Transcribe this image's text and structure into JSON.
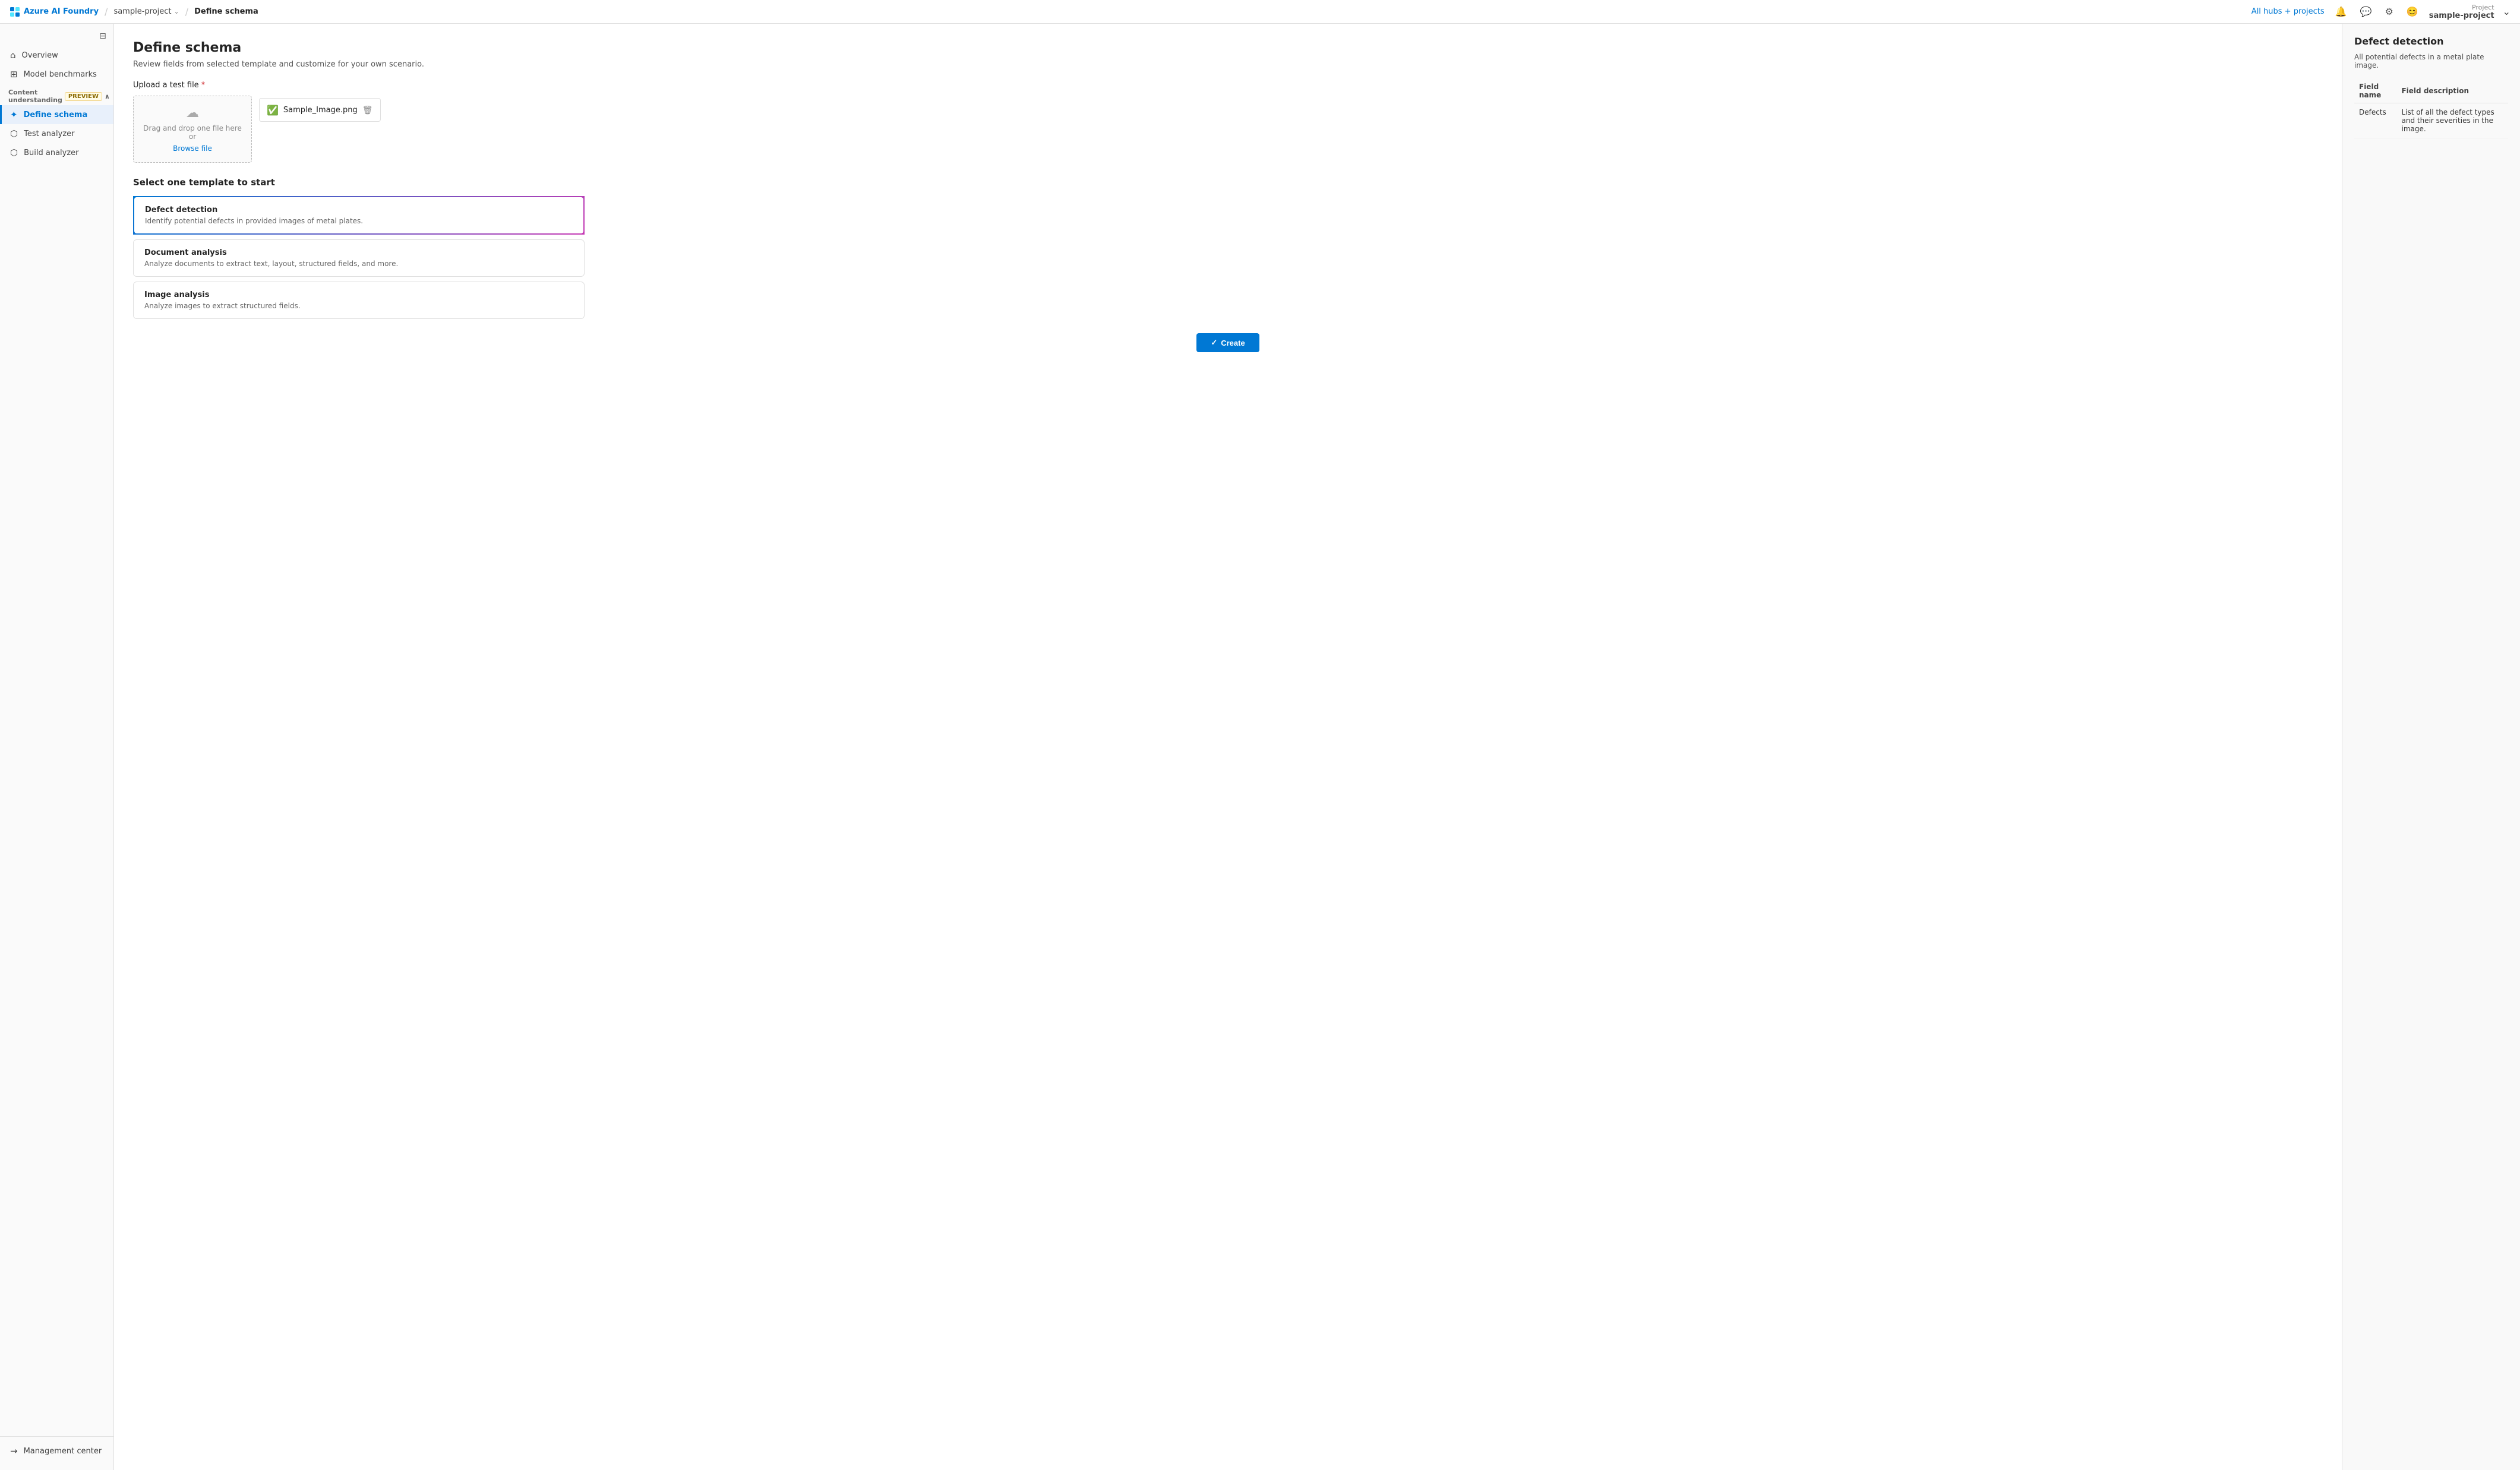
{
  "topnav": {
    "brand_label": "Azure AI Foundry",
    "breadcrumb_project": "sample-project",
    "breadcrumb_page": "Define schema",
    "hub_label": "All hubs + projects",
    "project_label": "Project",
    "project_name": "sample-project"
  },
  "sidebar": {
    "collapse_icon": "⊟",
    "items": [
      {
        "id": "overview",
        "label": "Overview",
        "icon": "⌂"
      },
      {
        "id": "model-benchmarks",
        "label": "Model benchmarks",
        "icon": "⊞"
      }
    ],
    "section_label": "Content understanding",
    "preview_badge": "PREVIEW",
    "section_icon": "∧",
    "sub_items": [
      {
        "id": "define-schema",
        "label": "Define schema",
        "icon": "✦",
        "active": true
      },
      {
        "id": "test-analyzer",
        "label": "Test analyzer",
        "icon": "⬡"
      },
      {
        "id": "build-analyzer",
        "label": "Build analyzer",
        "icon": "⬡"
      }
    ],
    "bottom": {
      "label": "Management center",
      "icon": "→"
    }
  },
  "main": {
    "page_title": "Define schema",
    "page_subtitle": "Review fields from selected template and customize for your own scenario.",
    "upload_section_label": "Upload a test file",
    "upload_hint_line1": "Drag and drop one file here or",
    "upload_hint_link": "Browse file",
    "uploaded_filename": "Sample_Image.png",
    "template_section_title": "Select one template to start",
    "templates": [
      {
        "id": "defect-detection",
        "title": "Defect detection",
        "description": "Identify potential defects in provided images of metal plates.",
        "selected": true
      },
      {
        "id": "document-analysis",
        "title": "Document analysis",
        "description": "Analyze documents to extract text, layout, structured fields, and more.",
        "selected": false
      },
      {
        "id": "image-analysis",
        "title": "Image analysis",
        "description": "Analyze images to extract structured fields.",
        "selected": false
      }
    ],
    "create_btn_label": "Create"
  },
  "right_panel": {
    "title": "Defect detection",
    "subtitle": "All potential defects in a metal plate image.",
    "table_header_name": "Field name",
    "table_header_desc": "Field description",
    "rows": [
      {
        "name": "Defects",
        "description": "List of all the defect types and their severities in the image."
      }
    ]
  }
}
